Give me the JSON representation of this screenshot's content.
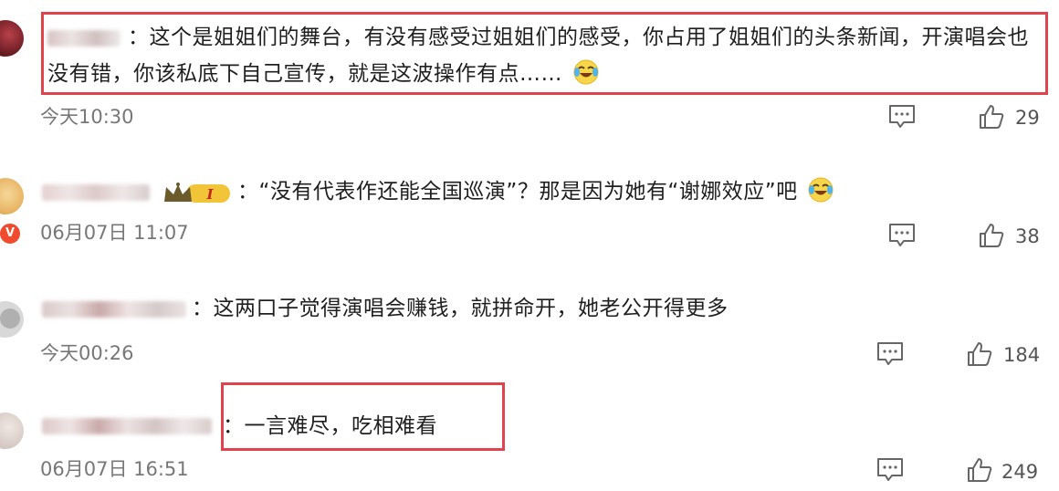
{
  "comments": [
    {
      "line1": "：这个是姐姐们的舞台，有没有感受过姐姐们的感受，你占用了姐姐们的头条新闻，开演唱会也",
      "line2": "没有错，你该私底下自己宣传，就是这波操作有点……",
      "time": "今天10:30",
      "likes": "29",
      "emoji": "crying-laughing-emoji"
    },
    {
      "line1": "：“没有代表作还能全国巡演”？那是因为她有“谢娜效应”吧",
      "time": "06月07日 11:07",
      "likes": "38",
      "badge_text": "I",
      "verified_text": "V",
      "emoji": "crying-laughing-emoji"
    },
    {
      "line1": "：这两口子觉得演唱会赚钱，就拼命开，她老公开得更多",
      "time": "今天00:26",
      "likes": "184"
    },
    {
      "line1": "：一言难尽，吃相难看",
      "time": "06月07日 16:51",
      "likes": "249"
    }
  ],
  "colors": {
    "highlight_border": "#e0434e",
    "text": "#1f1f1f",
    "meta_text": "#777777"
  },
  "icons": [
    "comment-icon",
    "thumbs-up-icon",
    "crying-laughing-emoji",
    "crown-badge-icon",
    "verified-v-icon"
  ]
}
